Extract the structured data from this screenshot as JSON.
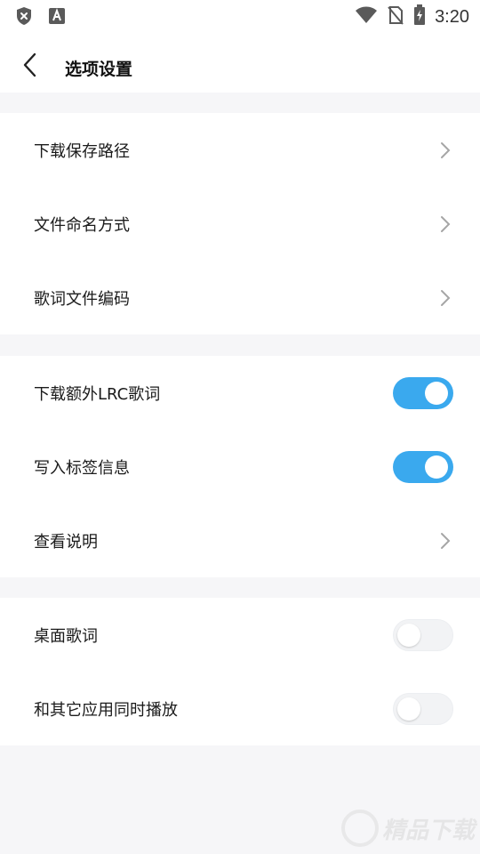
{
  "status_bar": {
    "time": "3:20",
    "icons": [
      "shield-x-icon",
      "a-notification-icon",
      "wifi-icon",
      "no-sim-icon",
      "battery-charging-icon"
    ]
  },
  "header": {
    "title": "选项设置",
    "back_icon": "chevron-left-icon"
  },
  "groups": [
    {
      "items": [
        {
          "label": "下载保存路径",
          "control": "chevron"
        },
        {
          "label": "文件命名方式",
          "control": "chevron"
        },
        {
          "label": "歌词文件编码",
          "control": "chevron"
        }
      ]
    },
    {
      "items": [
        {
          "label": "下载额外LRC歌词",
          "control": "toggle",
          "on": true
        },
        {
          "label": "写入标签信息",
          "control": "toggle",
          "on": true
        },
        {
          "label": "查看说明",
          "control": "chevron"
        }
      ]
    },
    {
      "items": [
        {
          "label": "桌面歌词",
          "control": "toggle",
          "on": false
        },
        {
          "label": "和其它应用同时播放",
          "control": "toggle",
          "on": false
        }
      ]
    }
  ],
  "colors": {
    "accent": "#3aa9ee",
    "background": "#f6f6f8",
    "card": "#ffffff"
  },
  "watermark": {
    "text": "精品下载"
  }
}
